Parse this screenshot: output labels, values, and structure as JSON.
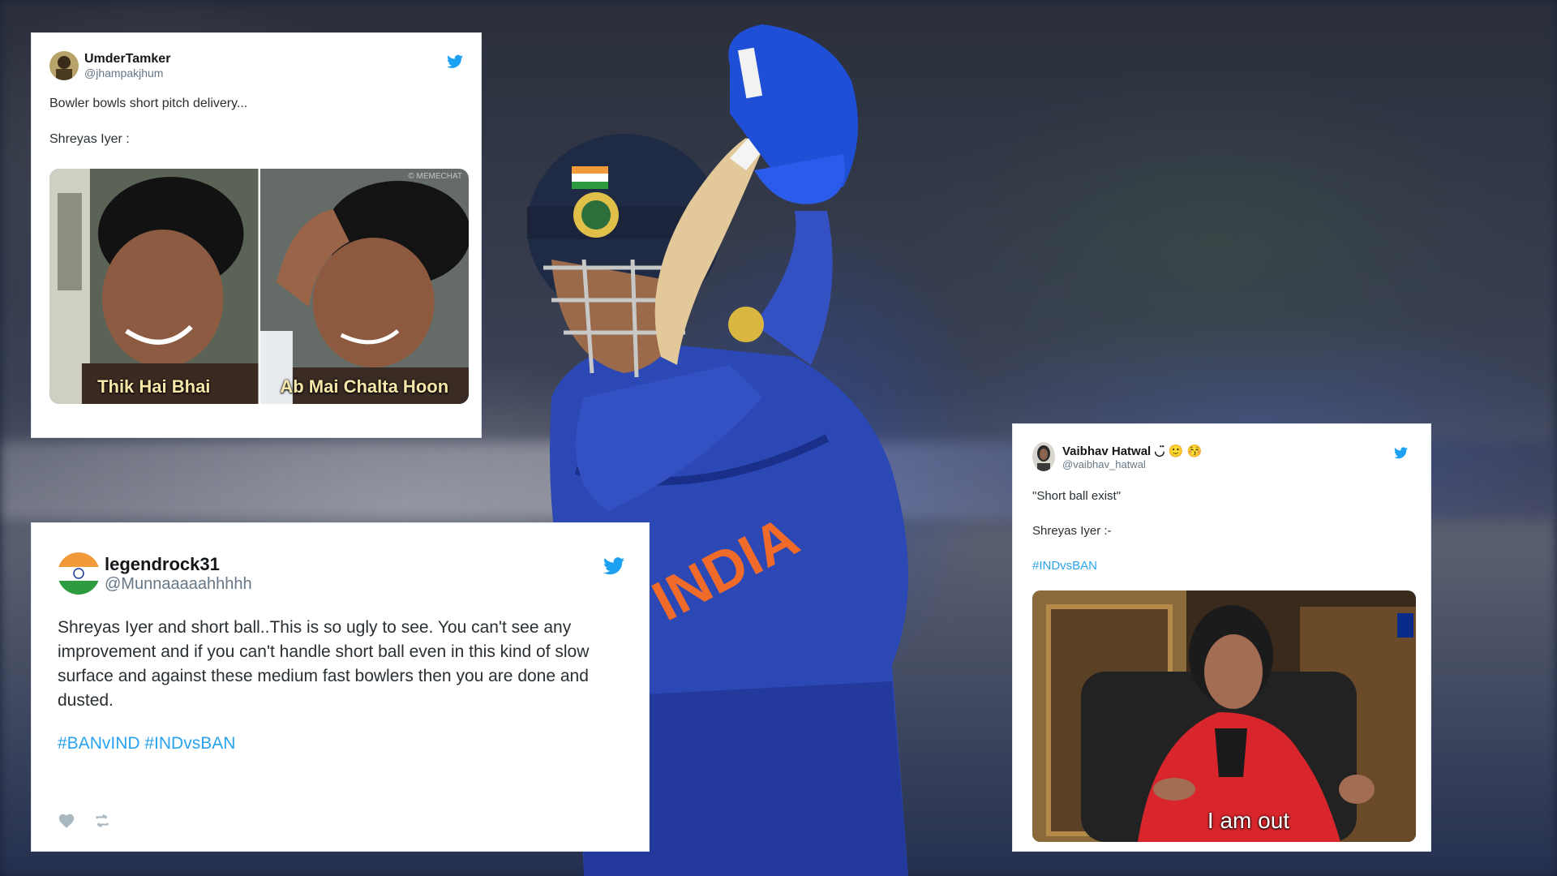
{
  "tweets": [
    {
      "display_name": "UmderTamker",
      "handle": "@jhampakjhum",
      "lines": [
        "Bowler bowls short pitch delivery...",
        "Shreyas Iyer :"
      ],
      "meme": {
        "captions": [
          "Thik Hai Bhai",
          "Ab Mai Chalta Hoon"
        ],
        "watermark": "© MEMECHAT"
      }
    },
    {
      "display_name": "legendrock31",
      "handle": "@Munnaaaaahhhhh",
      "text": "Shreyas Iyer and short ball..This is so ugly to see. You can't see any improvement and if you can't handle short ball even in this kind of slow surface and against these medium fast bowlers then you are done and dusted.",
      "hashtags": "#BANvIND #INDvsBAN"
    },
    {
      "display_name": "Vaibhav Hatwal ◡̈ 🙂 😚",
      "handle": "@vaibhav_hatwal",
      "lines": [
        "\"Short ball exist\"",
        "Shreyas Iyer :-"
      ],
      "hashtags": "#INDvsBAN",
      "meme": {
        "caption": "I am out"
      }
    }
  ],
  "icons": [
    "twitter-bird-icon",
    "heart-icon",
    "retweet-icon"
  ],
  "colors": {
    "twitter_blue": "#1da1f2",
    "hashtag": "#2aa3ef",
    "jersey_blue": "#2b46b8"
  }
}
